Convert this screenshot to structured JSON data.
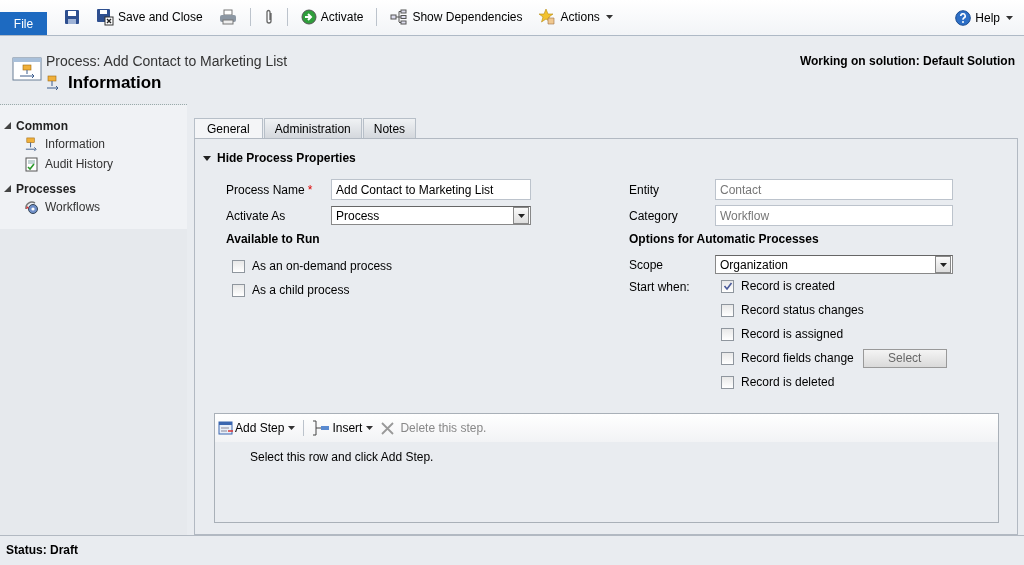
{
  "toolbar": {
    "file_tab": "File",
    "items": [
      {
        "kind": "save"
      },
      {
        "kind": "save_close",
        "label": "Save and Close"
      },
      {
        "kind": "print"
      },
      {
        "kind": "separator"
      },
      {
        "kind": "attach"
      },
      {
        "kind": "separator"
      },
      {
        "kind": "activate",
        "label": "Activate"
      },
      {
        "kind": "separator"
      },
      {
        "kind": "dependencies",
        "label": "Show Dependencies"
      },
      {
        "kind": "actions",
        "label": "Actions",
        "dropdown": true
      }
    ],
    "help": {
      "label": "Help",
      "dropdown": true
    }
  },
  "header": {
    "record_title": "Process: Add Contact to Marketing List",
    "form_title": "Information",
    "solution": "Working on solution: Default Solution"
  },
  "nav": [
    {
      "title": "Common",
      "expanded": true,
      "items": [
        {
          "kind": "information",
          "label": "Information",
          "selected": false
        },
        {
          "kind": "audit",
          "label": "Audit History",
          "selected": false
        }
      ]
    },
    {
      "title": "Processes",
      "expanded": true,
      "items": [
        {
          "kind": "workflow",
          "label": "Workflows",
          "selected": false
        }
      ]
    }
  ],
  "tabs": [
    {
      "label": "General",
      "selected": true
    },
    {
      "label": "Administration",
      "selected": false
    },
    {
      "label": "Notes",
      "selected": false
    }
  ],
  "section": {
    "title": "Hide Process Properties",
    "expanded": true
  },
  "left": {
    "process_name": {
      "label": "Process Name",
      "required": true,
      "required_mark": "*",
      "value": "Add Contact to Marketing List"
    },
    "activate_as": {
      "label": "Activate As",
      "value": "Process"
    },
    "available_heading": "Available to Run",
    "available": [
      {
        "label": "As an on-demand process",
        "checked": false
      },
      {
        "label": "As a child process",
        "checked": false
      }
    ]
  },
  "right": {
    "entity": {
      "label": "Entity",
      "value": "Contact",
      "disabled": true
    },
    "category": {
      "label": "Category",
      "value": "Workflow",
      "disabled": true
    },
    "options_heading": "Options for Automatic Processes",
    "scope": {
      "label": "Scope",
      "value": "Organization"
    },
    "start_label": "Start when:",
    "start_options": [
      {
        "label": "Record is created",
        "checked": true
      },
      {
        "label": "Record status changes",
        "checked": false
      },
      {
        "label": "Record is assigned",
        "checked": false
      },
      {
        "label": "Record fields change",
        "checked": false,
        "button": "Select"
      },
      {
        "label": "Record is deleted",
        "checked": false
      }
    ]
  },
  "steps": {
    "add_step": "Add Step",
    "insert": "Insert",
    "delete": {
      "label": "Delete this step.",
      "disabled": true
    },
    "hint": "Select this row and click Add Step."
  },
  "status_bar": "Status: Draft"
}
